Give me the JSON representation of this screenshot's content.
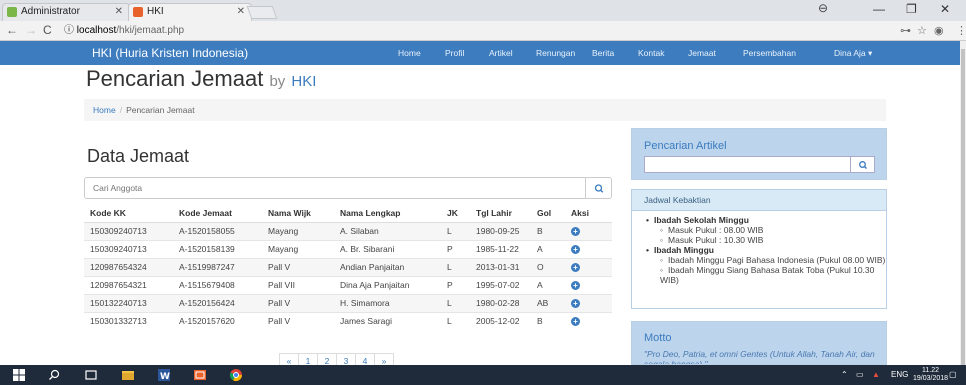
{
  "browser": {
    "tabs": [
      {
        "label": "Administrator"
      },
      {
        "label": "HKI"
      }
    ],
    "url_host": "localhost",
    "url_path": "/hki/jemaat.php"
  },
  "navbar": {
    "brand": "HKI (Huria Kristen Indonesia)",
    "links": [
      "Home",
      "Profil",
      "Artikel",
      "Renungan",
      "Berita",
      "Kontak",
      "Jemaat",
      "Persembahan",
      "Dina Aja ▾"
    ]
  },
  "page": {
    "title": "Pencarian Jemaat",
    "by": "by",
    "brand": "HKI",
    "breadcrumb": {
      "home": "Home",
      "sep": "/",
      "current": "Pencarian Jemaat"
    }
  },
  "main": {
    "section_title": "Data Jemaat",
    "search_placeholder": "Cari Anggota",
    "table": {
      "headers": [
        "Kode KK",
        "Kode Jemaat",
        "Nama Wijk",
        "Nama Lengkap",
        "JK",
        "Tgl Lahir",
        "Gol",
        "Aksi"
      ],
      "rows": [
        [
          "150309240713",
          "A-1520158055",
          "Mayang",
          "A. Silaban",
          "L",
          "1980-09-25",
          "B"
        ],
        [
          "150309240713",
          "A-1520158139",
          "Mayang",
          "A. Br. Sibarani",
          "P",
          "1985-11-22",
          "A"
        ],
        [
          "120987654324",
          "A-1519987247",
          "Pall V",
          "Andian Panjaitan",
          "L",
          "2013-01-31",
          "O"
        ],
        [
          "120987654321",
          "A-1515679408",
          "Pall VII",
          "Dina Aja Panjaitan",
          "P",
          "1995-07-02",
          "A"
        ],
        [
          "150132240713",
          "A-1520156424",
          "Pall V",
          "H. Simamora",
          "L",
          "1980-02-28",
          "AB"
        ],
        [
          "150301332713",
          "A-1520157620",
          "Pall V",
          "James Saragi",
          "L",
          "2005-12-02",
          "B"
        ]
      ]
    },
    "pagination": [
      "«",
      "1",
      "2",
      "3",
      "4",
      "»"
    ]
  },
  "sidebar": {
    "search_title": "Pencarian Artikel",
    "jadwal": {
      "title": "Jadwal Kebaktian",
      "items": [
        {
          "label": "Ibadah Sekolah Minggu",
          "sub": [
            "Masuk Pukul : 08.00 WIB",
            "Masuk Pukul : 10.30 WIB"
          ]
        },
        {
          "label": "Ibadah Minggu",
          "sub": [
            "Ibadah Minggu Pagi Bahasa Indonesia (Pukul 08.00 WIB)",
            "Ibadah Minggu Siang Bahasa Batak Toba (Pukul 10.30 WIB)"
          ]
        }
      ]
    },
    "motto": {
      "title": "Motto",
      "quote": "\"Pro Deo, Patria, et omni Gentes (Untuk Allah, Tanah Air, dan segala bangsa).\""
    }
  },
  "taskbar": {
    "lang": "ENG",
    "time": "11.22",
    "date": "19/03/2018"
  },
  "colors": {
    "accent": "#3c7cbf",
    "panel": "#bcd4ec",
    "taskbar": "#1f2a3a"
  }
}
